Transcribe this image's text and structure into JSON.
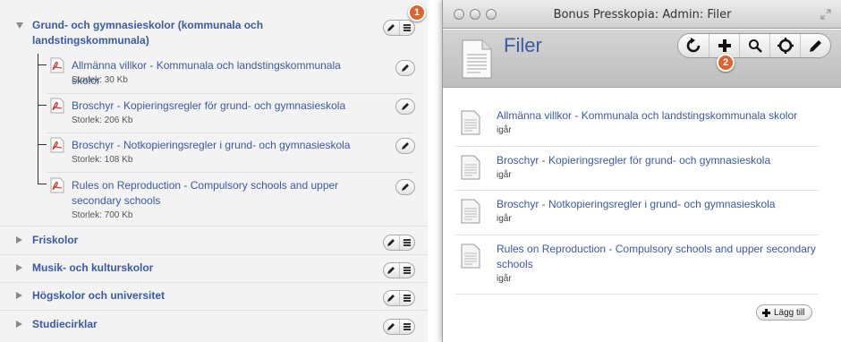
{
  "left_panel": {
    "categories": [
      {
        "title": "Grund- och gymnasieskolor (kommunala och landstingskommunala)",
        "expanded": true
      },
      {
        "title": "Friskolor",
        "expanded": false
      },
      {
        "title": "Musik- och kulturskolor",
        "expanded": false
      },
      {
        "title": "Högskolor och universitet",
        "expanded": false
      },
      {
        "title": "Studiecirklar",
        "expanded": false
      }
    ],
    "files": [
      {
        "name": "Allmänna villkor - Kommunala och landstingskommunala skolor",
        "size": "Storlek: 30 Kb"
      },
      {
        "name": "Broschyr - Kopieringsregler för grund- och gymnasieskola",
        "size": "Storlek: 206 Kb"
      },
      {
        "name": "Broschyr - Notkopieringsregler i grund- och gymnasieskola",
        "size": "Storlek: 108 Kb"
      },
      {
        "name": "Rules on Reproduction - Compulsory schools and upper secondary schools",
        "size": "Storlek: 700 Kb"
      }
    ]
  },
  "callouts": {
    "one": "1",
    "two": "2"
  },
  "window": {
    "title": "Bonus Presskopia: Admin: Filer",
    "heading": "Filer",
    "toolbar_icons": [
      "refresh-icon",
      "add-icon",
      "search-icon",
      "settings-icon",
      "edit-icon"
    ],
    "files": [
      {
        "name": "Allmänna villkor - Kommunala och landstingskommunala skolor",
        "date": "igår"
      },
      {
        "name": "Broschyr - Kopieringsregler för grund- och gymnasieskola",
        "date": "igår"
      },
      {
        "name": "Broschyr - Notkopieringsregler i grund- och gymnasieskola",
        "date": "igår"
      },
      {
        "name": "Rules on Reproduction - Compulsory schools and upper secondary schools",
        "date": "igår"
      }
    ],
    "add_button_label": "Lägg till"
  },
  "colors": {
    "link": "#3b5aa3",
    "badge": "#e2612c",
    "pdf_red": "#d0392b"
  }
}
